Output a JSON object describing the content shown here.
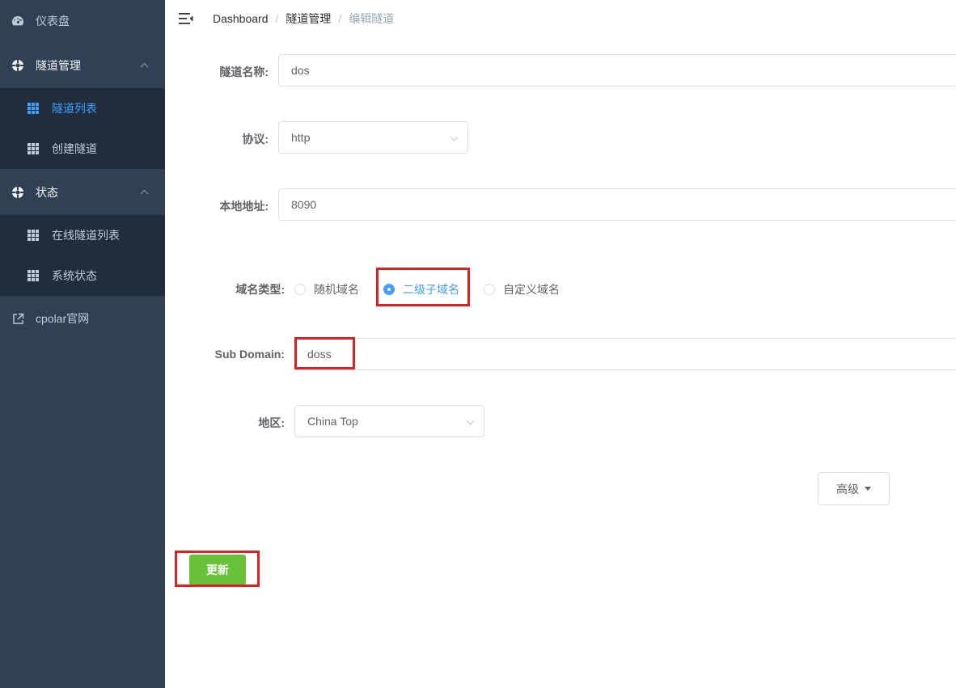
{
  "sidebar": {
    "dashboard": "仪表盘",
    "tunnel_mgmt": "隧道管理",
    "tunnel_list": "隧道列表",
    "create_tunnel": "创建隧道",
    "status": "状态",
    "online_tunnels": "在线隧道列表",
    "system_status": "系统状态",
    "official_site": "cpolar官网"
  },
  "breadcrumb": {
    "dashboard": "Dashboard",
    "sep1": "/",
    "tunnel_mgmt": "隧道管理",
    "sep2": "/",
    "edit": "编辑隧道"
  },
  "form": {
    "name_label": "隧道名称:",
    "name_value": "dos",
    "protocol_label": "协议:",
    "protocol_value": "http",
    "local_label": "本地地址:",
    "local_value": "8090",
    "domain_type_label": "域名类型:",
    "domain_types": [
      "随机域名",
      "二级子域名",
      "自定义域名"
    ],
    "domain_type_selected": "二级子域名",
    "subdomain_label": "Sub Domain:",
    "subdomain_value": "doss",
    "region_label": "地区:",
    "region_value": "China Top",
    "advanced_label": "高级",
    "update_label": "更新"
  },
  "colors": {
    "sidebar_bg": "#304156",
    "submenu_bg": "#1f2d3d",
    "active": "#409eff",
    "success": "#67c23a",
    "highlight": "#e02020"
  }
}
